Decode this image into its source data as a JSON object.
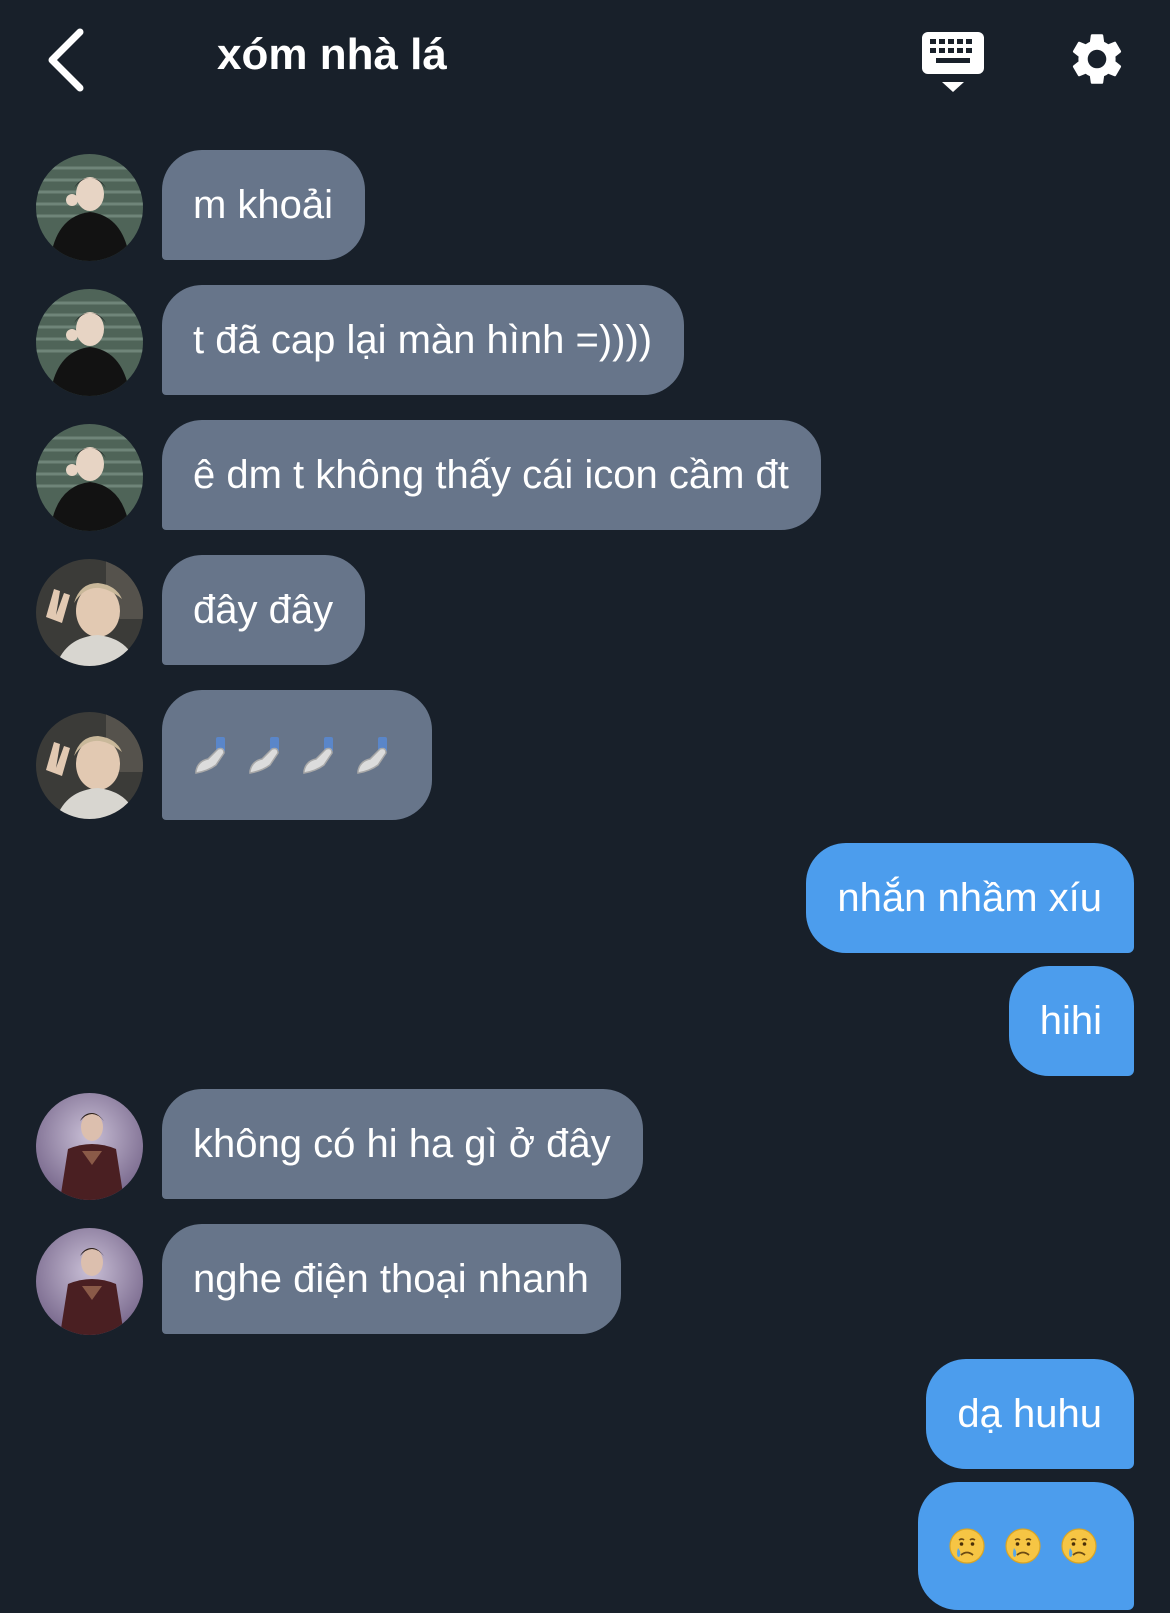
{
  "header": {
    "title": "xóm nhà lá",
    "back_icon": "chevron-left-icon",
    "keyboard_icon": "keyboard-icon",
    "settings_icon": "gear-icon"
  },
  "colors": {
    "background": "#18202a",
    "incoming_bubble": "#67758a",
    "outgoing_bubble": "#4c9ded",
    "text": "#ffffff"
  },
  "messages": [
    {
      "side": "in",
      "sender_avatar": "avatar-a",
      "text": "m khoải"
    },
    {
      "side": "in",
      "sender_avatar": "avatar-a",
      "text": "t đã cap lại màn hình =))))"
    },
    {
      "side": "in",
      "sender_avatar": "avatar-a",
      "text": "ê dm t không thấy cái icon cầm đt"
    },
    {
      "side": "in",
      "sender_avatar": "avatar-b",
      "text": "đây đây"
    },
    {
      "side": "in",
      "sender_avatar": "avatar-b",
      "emoji": [
        "hand-holding-phone",
        "hand-holding-phone",
        "hand-holding-phone",
        "hand-holding-phone"
      ]
    },
    {
      "side": "out",
      "text": "nhắn nhầm xíu"
    },
    {
      "side": "out",
      "text": "hihi"
    },
    {
      "side": "in",
      "sender_avatar": "avatar-c",
      "text": "không có hi ha gì ở đây"
    },
    {
      "side": "in",
      "sender_avatar": "avatar-c",
      "text": "nghe điện thoại nhanh"
    },
    {
      "side": "out",
      "text": "dạ huhu"
    },
    {
      "side": "out",
      "emoji": [
        "crying-face",
        "crying-face",
        "crying-face"
      ]
    }
  ]
}
